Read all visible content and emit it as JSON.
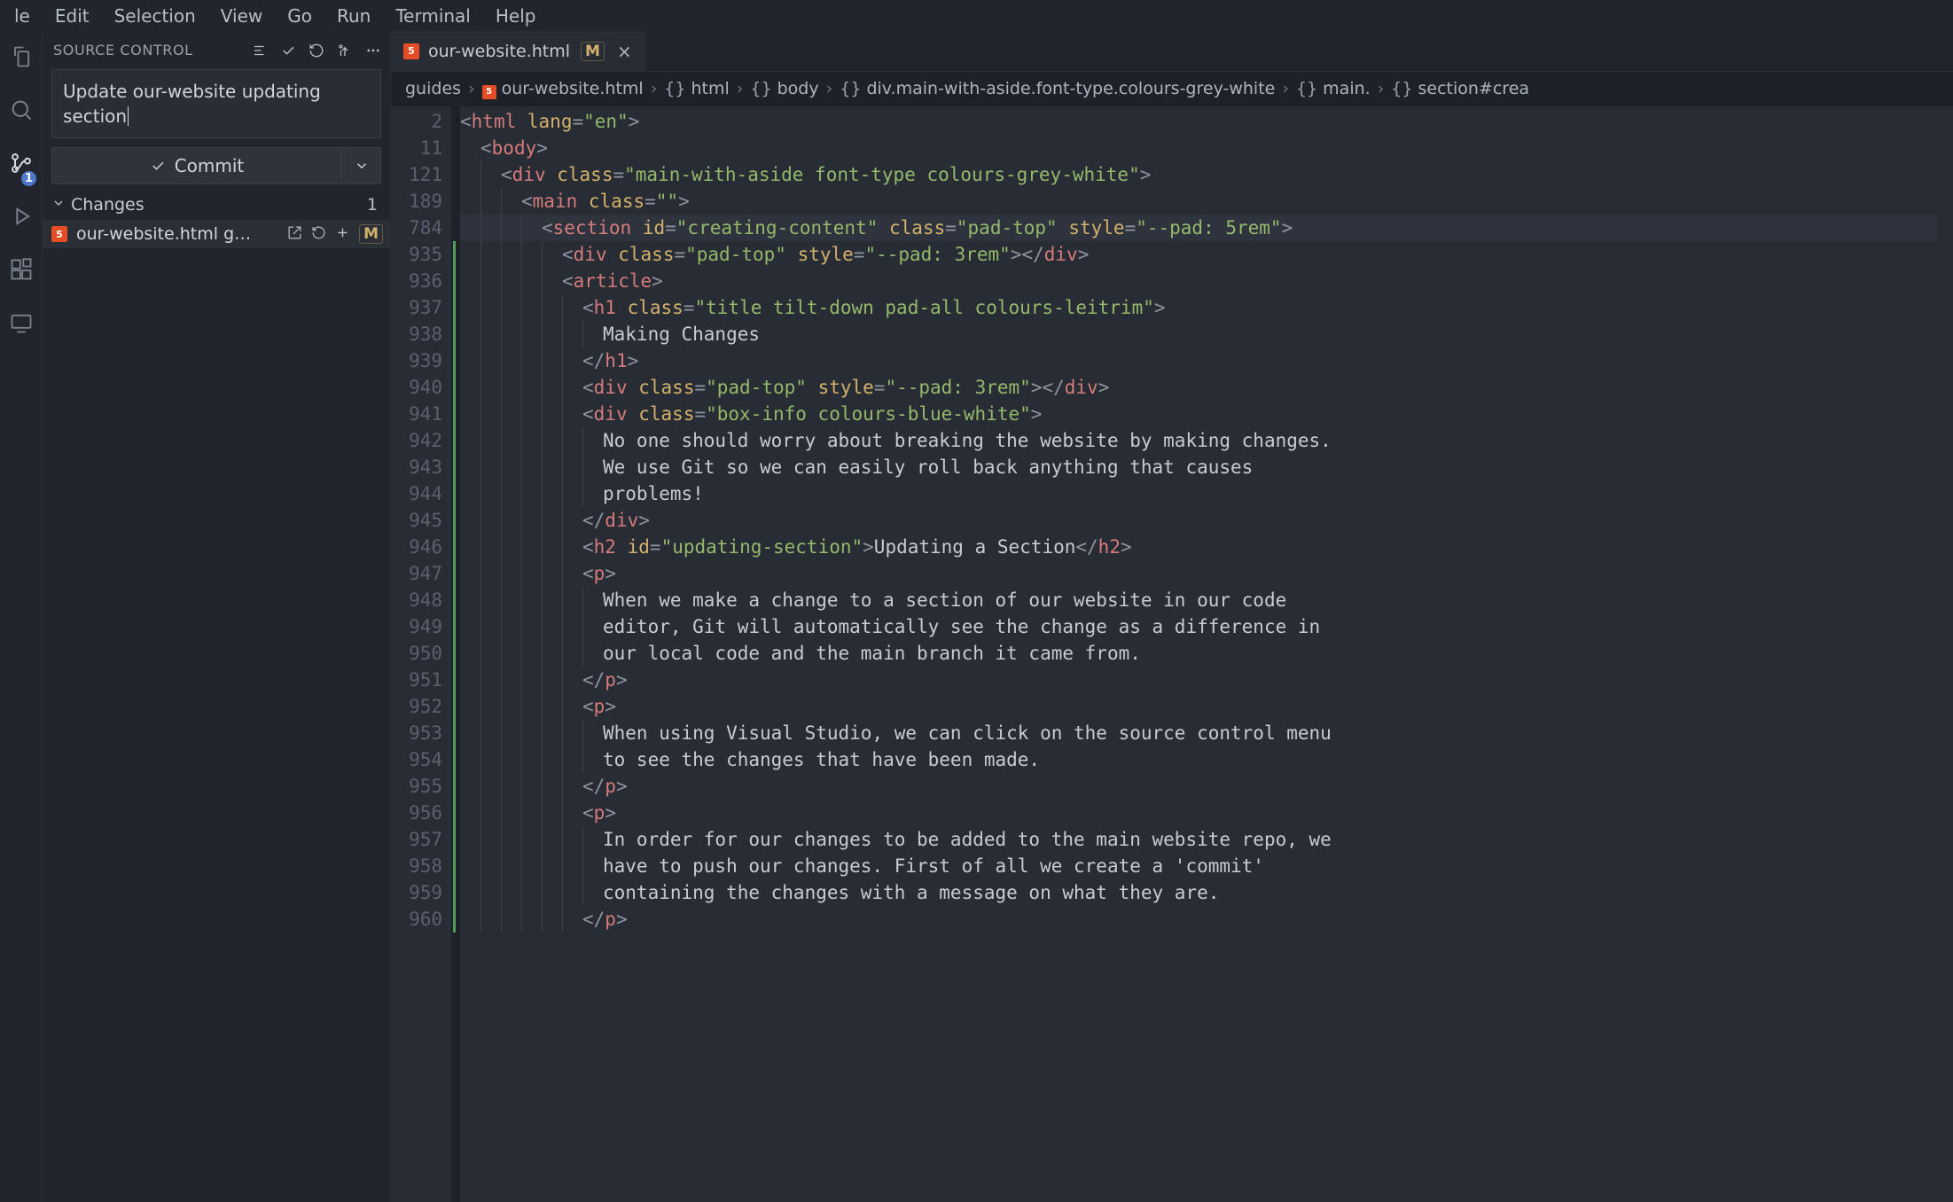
{
  "menubar": [
    "le",
    "Edit",
    "Selection",
    "View",
    "Go",
    "Run",
    "Terminal",
    "Help"
  ],
  "scm": {
    "title": "SOURCE CONTROL",
    "badge": "1",
    "commit_message": "Update our-website updating section",
    "commit_button": "Commit",
    "changes_label": "Changes",
    "changes_count": "1",
    "file": "our-website.html g…",
    "file_status": "M"
  },
  "tab": {
    "filename": "our-website.html",
    "status": "M"
  },
  "breadcrumbs": [
    {
      "label": "guides"
    },
    {
      "label": "our-website.html",
      "icon": "html"
    },
    {
      "label": "html",
      "icon": "brace"
    },
    {
      "label": "body",
      "icon": "brace"
    },
    {
      "label": "div.main-with-aside.font-type.colours-grey-white",
      "icon": "brace"
    },
    {
      "label": "main.",
      "icon": "brace"
    },
    {
      "label": "section#crea",
      "icon": "brace"
    }
  ],
  "editor": {
    "lines": [
      {
        "n": 2,
        "indent": 0,
        "gutter": "",
        "hl": false,
        "tokens": [
          [
            "punct",
            "<"
          ],
          [
            "tag",
            "html"
          ],
          [
            "text",
            " "
          ],
          [
            "attr",
            "lang"
          ],
          [
            "punct",
            "="
          ],
          [
            "str",
            "\"en\""
          ],
          [
            "punct",
            ">"
          ]
        ]
      },
      {
        "n": 11,
        "indent": 1,
        "gutter": "",
        "hl": false,
        "tokens": [
          [
            "punct",
            "<"
          ],
          [
            "tag",
            "body"
          ],
          [
            "punct",
            ">"
          ]
        ]
      },
      {
        "n": 121,
        "indent": 2,
        "gutter": "",
        "hl": false,
        "tokens": [
          [
            "punct",
            "<"
          ],
          [
            "tag",
            "div"
          ],
          [
            "text",
            " "
          ],
          [
            "attr",
            "class"
          ],
          [
            "punct",
            "="
          ],
          [
            "str",
            "\"main-with-aside font-type colours-grey-white\""
          ],
          [
            "punct",
            ">"
          ]
        ]
      },
      {
        "n": 189,
        "indent": 3,
        "gutter": "",
        "hl": false,
        "tokens": [
          [
            "punct",
            "<"
          ],
          [
            "tag",
            "main"
          ],
          [
            "text",
            " "
          ],
          [
            "attr",
            "class"
          ],
          [
            "punct",
            "="
          ],
          [
            "str",
            "\"\""
          ],
          [
            "punct",
            ">"
          ]
        ]
      },
      {
        "n": 784,
        "indent": 4,
        "gutter": "",
        "hl": true,
        "tokens": [
          [
            "punct",
            "<"
          ],
          [
            "tag",
            "section"
          ],
          [
            "text",
            " "
          ],
          [
            "attr",
            "id"
          ],
          [
            "punct",
            "="
          ],
          [
            "str",
            "\"creating-content\""
          ],
          [
            "text",
            " "
          ],
          [
            "attr",
            "class"
          ],
          [
            "punct",
            "="
          ],
          [
            "str",
            "\"pad-top\""
          ],
          [
            "text",
            " "
          ],
          [
            "attr",
            "style"
          ],
          [
            "punct",
            "="
          ],
          [
            "str",
            "\"--pad: 5rem\""
          ],
          [
            "punct",
            ">"
          ]
        ]
      },
      {
        "n": 935,
        "indent": 5,
        "gutter": "green",
        "hl": false,
        "tokens": [
          [
            "punct",
            "<"
          ],
          [
            "tag",
            "div"
          ],
          [
            "text",
            " "
          ],
          [
            "attr",
            "class"
          ],
          [
            "punct",
            "="
          ],
          [
            "str",
            "\"pad-top\""
          ],
          [
            "text",
            " "
          ],
          [
            "attr",
            "style"
          ],
          [
            "punct",
            "="
          ],
          [
            "str",
            "\"--pad: 3rem\""
          ],
          [
            "punct",
            "></"
          ],
          [
            "tag",
            "div"
          ],
          [
            "punct",
            ">"
          ]
        ]
      },
      {
        "n": 936,
        "indent": 5,
        "gutter": "green",
        "hl": false,
        "tokens": [
          [
            "punct",
            "<"
          ],
          [
            "tag",
            "article"
          ],
          [
            "punct",
            ">"
          ]
        ]
      },
      {
        "n": 937,
        "indent": 6,
        "gutter": "green",
        "hl": false,
        "tokens": [
          [
            "punct",
            "<"
          ],
          [
            "tag",
            "h1"
          ],
          [
            "text",
            " "
          ],
          [
            "attr",
            "class"
          ],
          [
            "punct",
            "="
          ],
          [
            "str",
            "\"title tilt-down pad-all colours-leitrim\""
          ],
          [
            "punct",
            ">"
          ]
        ]
      },
      {
        "n": 938,
        "indent": 7,
        "gutter": "green",
        "hl": false,
        "tokens": [
          [
            "text",
            "Making Changes"
          ]
        ]
      },
      {
        "n": 939,
        "indent": 6,
        "gutter": "green",
        "hl": false,
        "tokens": [
          [
            "punct",
            "</"
          ],
          [
            "tag",
            "h1"
          ],
          [
            "punct",
            ">"
          ]
        ]
      },
      {
        "n": 940,
        "indent": 6,
        "gutter": "green",
        "hl": false,
        "tokens": [
          [
            "punct",
            "<"
          ],
          [
            "tag",
            "div"
          ],
          [
            "text",
            " "
          ],
          [
            "attr",
            "class"
          ],
          [
            "punct",
            "="
          ],
          [
            "str",
            "\"pad-top\""
          ],
          [
            "text",
            " "
          ],
          [
            "attr",
            "style"
          ],
          [
            "punct",
            "="
          ],
          [
            "str",
            "\"--pad: 3rem\""
          ],
          [
            "punct",
            "></"
          ],
          [
            "tag",
            "div"
          ],
          [
            "punct",
            ">"
          ]
        ]
      },
      {
        "n": 941,
        "indent": 6,
        "gutter": "green",
        "hl": false,
        "tokens": [
          [
            "punct",
            "<"
          ],
          [
            "tag",
            "div"
          ],
          [
            "text",
            " "
          ],
          [
            "attr",
            "class"
          ],
          [
            "punct",
            "="
          ],
          [
            "str",
            "\"box-info colours-blue-white\""
          ],
          [
            "punct",
            ">"
          ]
        ]
      },
      {
        "n": 942,
        "indent": 7,
        "gutter": "green",
        "hl": false,
        "tokens": [
          [
            "text",
            "No one should worry about breaking the website by making changes."
          ]
        ]
      },
      {
        "n": 943,
        "indent": 7,
        "gutter": "green",
        "hl": false,
        "tokens": [
          [
            "text",
            "We use Git so we can easily roll back anything that causes"
          ]
        ]
      },
      {
        "n": 944,
        "indent": 7,
        "gutter": "green",
        "hl": false,
        "tokens": [
          [
            "text",
            "problems!"
          ]
        ]
      },
      {
        "n": 945,
        "indent": 6,
        "gutter": "green",
        "hl": false,
        "tokens": [
          [
            "punct",
            "</"
          ],
          [
            "tag",
            "div"
          ],
          [
            "punct",
            ">"
          ]
        ]
      },
      {
        "n": 946,
        "indent": 6,
        "gutter": "green",
        "hl": false,
        "tokens": [
          [
            "punct",
            "<"
          ],
          [
            "tag",
            "h2"
          ],
          [
            "text",
            " "
          ],
          [
            "attr",
            "id"
          ],
          [
            "punct",
            "="
          ],
          [
            "str",
            "\"updating-section\""
          ],
          [
            "punct",
            ">"
          ],
          [
            "text",
            "Updating a Section"
          ],
          [
            "punct",
            "</"
          ],
          [
            "tag",
            "h2"
          ],
          [
            "punct",
            ">"
          ]
        ]
      },
      {
        "n": 947,
        "indent": 6,
        "gutter": "green",
        "hl": false,
        "tokens": [
          [
            "punct",
            "<"
          ],
          [
            "tag",
            "p"
          ],
          [
            "punct",
            ">"
          ]
        ]
      },
      {
        "n": 948,
        "indent": 7,
        "gutter": "green",
        "hl": false,
        "tokens": [
          [
            "text",
            "When we make a change to a section of our website in our code"
          ]
        ]
      },
      {
        "n": 949,
        "indent": 7,
        "gutter": "green",
        "hl": false,
        "tokens": [
          [
            "text",
            "editor, Git will automatically see the change as a difference in"
          ]
        ]
      },
      {
        "n": 950,
        "indent": 7,
        "gutter": "green",
        "hl": false,
        "tokens": [
          [
            "text",
            "our local code and the main branch it came from."
          ]
        ]
      },
      {
        "n": 951,
        "indent": 6,
        "gutter": "green",
        "hl": false,
        "tokens": [
          [
            "punct",
            "</"
          ],
          [
            "tag",
            "p"
          ],
          [
            "punct",
            ">"
          ]
        ]
      },
      {
        "n": 952,
        "indent": 6,
        "gutter": "green",
        "hl": false,
        "tokens": [
          [
            "punct",
            "<"
          ],
          [
            "tag",
            "p"
          ],
          [
            "punct",
            ">"
          ]
        ]
      },
      {
        "n": 953,
        "indent": 7,
        "gutter": "green",
        "hl": false,
        "tokens": [
          [
            "text",
            "When using Visual Studio, we can click on the source control menu"
          ]
        ]
      },
      {
        "n": 954,
        "indent": 7,
        "gutter": "green",
        "hl": false,
        "tokens": [
          [
            "text",
            "to see the changes that have been made."
          ]
        ]
      },
      {
        "n": 955,
        "indent": 6,
        "gutter": "green",
        "hl": false,
        "tokens": [
          [
            "punct",
            "</"
          ],
          [
            "tag",
            "p"
          ],
          [
            "punct",
            ">"
          ]
        ]
      },
      {
        "n": 956,
        "indent": 6,
        "gutter": "green",
        "hl": false,
        "tokens": [
          [
            "punct",
            "<"
          ],
          [
            "tag",
            "p"
          ],
          [
            "punct",
            ">"
          ]
        ]
      },
      {
        "n": 957,
        "indent": 7,
        "gutter": "green",
        "hl": false,
        "tokens": [
          [
            "text",
            "In order for our changes to be added to the main website repo, we"
          ]
        ]
      },
      {
        "n": 958,
        "indent": 7,
        "gutter": "green",
        "hl": false,
        "tokens": [
          [
            "text",
            "have to push our changes. First of all we create a 'commit'"
          ]
        ]
      },
      {
        "n": 959,
        "indent": 7,
        "gutter": "green",
        "hl": false,
        "tokens": [
          [
            "text",
            "containing the changes with a message on what they are."
          ]
        ]
      },
      {
        "n": 960,
        "indent": 6,
        "gutter": "green",
        "hl": false,
        "tokens": [
          [
            "punct",
            "</"
          ],
          [
            "tag",
            "p"
          ],
          [
            "punct",
            ">"
          ]
        ]
      }
    ]
  }
}
